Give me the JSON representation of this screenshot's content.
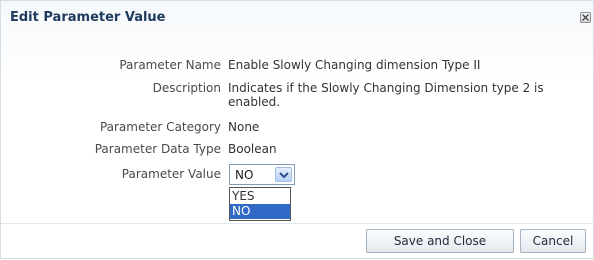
{
  "dialog": {
    "title": "Edit Parameter Value",
    "close_icon": "close-x-icon"
  },
  "fields": {
    "parameter_name": {
      "label": "Parameter Name",
      "value": "Enable Slowly Changing dimension Type II"
    },
    "description": {
      "label": "Description",
      "value": "Indicates if the Slowly Changing Dimension type 2 is enabled."
    },
    "parameter_category": {
      "label": "Parameter Category",
      "value": "None"
    },
    "parameter_data_type": {
      "label": "Parameter Data Type",
      "value": "Boolean"
    },
    "parameter_value": {
      "label": "Parameter Value",
      "selected": "NO"
    }
  },
  "dropdown": {
    "options": [
      "YES",
      "NO"
    ],
    "highlighted": "NO",
    "highlight_color": "#3169c6"
  },
  "buttons": {
    "save_label": "Save and Close",
    "cancel_label": "Cancel"
  }
}
